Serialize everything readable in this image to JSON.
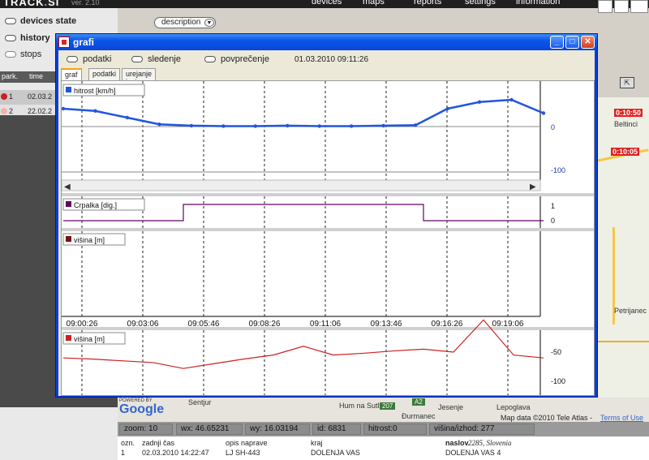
{
  "app": {
    "version": "ver. 2.10",
    "nav": [
      "devices",
      "maps",
      "reports",
      "settings",
      "information"
    ]
  },
  "left": {
    "devices_state": "devices state",
    "history": "history",
    "stops": "stops",
    "description": "description",
    "list_headers": [
      "park.",
      "time"
    ],
    "rows": [
      {
        "id": "1",
        "time": "02.03.2",
        "color": "#cc2020"
      },
      {
        "id": "2",
        "time": "22.02.2",
        "color": "#f4b0b0"
      }
    ]
  },
  "window": {
    "title": "grafi",
    "radios": [
      "podatki",
      "sledenje",
      "povprečenje"
    ],
    "datetime": "01.03.2010 09:11:26",
    "tabs": [
      "graf",
      "podatki",
      "urejanje izpisov"
    ]
  },
  "chart_data": [
    {
      "type": "line",
      "title": "hitrost [km/h]",
      "series_color": "#2255dd",
      "yticks": [
        "0",
        "-100"
      ],
      "x": [
        "09:00:26",
        "09:03:06",
        "09:05:46",
        "09:08:26",
        "09:11:06",
        "09:13:46",
        "09:16:26",
        "09:19:06"
      ],
      "values": [
        40,
        35,
        20,
        5,
        2,
        1,
        1,
        2,
        1,
        1,
        2,
        3,
        40,
        55,
        60,
        30
      ]
    },
    {
      "type": "line",
      "title": "Crpalka [dig.]",
      "series_color": "#660066",
      "yticks": [
        "1",
        "0"
      ],
      "x": [
        "09:00:26",
        "09:03:06",
        "09:05:46",
        "09:08:26",
        "09:11:06",
        "09:13:46",
        "09:16:26",
        "09:19:06"
      ],
      "values": [
        0,
        0,
        1,
        1,
        1,
        1,
        0,
        0
      ]
    },
    {
      "type": "line",
      "title": "višina [m]",
      "series_color": "#7a1010",
      "x": [
        "09:00:26",
        "09:03:06",
        "09:05:46",
        "09:08:26",
        "09:11:06",
        "09:13:46",
        "09:16:26",
        "09:19:06"
      ],
      "values": []
    },
    {
      "type": "line",
      "title": "višina [m]",
      "series_color": "#cc2020",
      "yticks": [
        "-50",
        "-100"
      ],
      "values": [
        -60,
        -62,
        -65,
        -68,
        -78,
        -70,
        -62,
        -55,
        -40,
        -55,
        -52,
        -48,
        -45,
        -50,
        5,
        -55,
        -60
      ]
    }
  ],
  "map": {
    "labels": [
      "Beltinci",
      "Petrijanec",
      "Hum na Sutli",
      "Đurmanec",
      "Jesenje",
      "Lepoglava",
      "Sentjur"
    ],
    "flags": [
      "0:10:50",
      "0:10:05"
    ],
    "shields": [
      "207",
      "A2"
    ],
    "powered_by": "POWERED BY",
    "google": "Google",
    "mapdata": "Map data ©2010 Tele Atlas -",
    "terms": "Terms of Use"
  },
  "status": {
    "zoom": "zoom: 10",
    "wx": "wx: 46.65231",
    "wy": "wy: 16.03194",
    "id": "id: 6831",
    "hitrost": "hitrost:0",
    "visina": "višina/izhod: 277"
  },
  "info": {
    "headers": [
      "ozn.",
      "zadnji čas",
      "opis naprave",
      "kraj",
      "naslov"
    ],
    "naslov_extra": "2285, Slovenia",
    "row": [
      "1",
      "02.03.2010 14:22:47",
      "LJ SH-443",
      "DOLENJA VAS",
      "DOLENJA VAS 4"
    ]
  }
}
